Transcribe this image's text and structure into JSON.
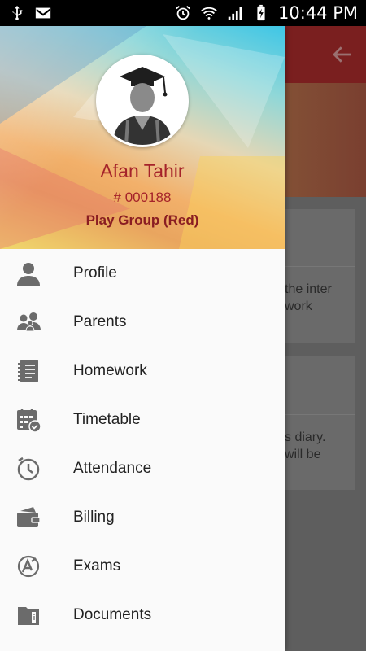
{
  "status_bar": {
    "time": "10:44 PM",
    "icons": [
      "usb-icon",
      "gmail-icon",
      "alarm-icon",
      "wifi-icon",
      "signal-icon",
      "battery-icon"
    ]
  },
  "background": {
    "card1_text": [
      "the inter",
      "work"
    ],
    "card2_text": [
      "s diary.",
      "will be"
    ]
  },
  "drawer": {
    "student": {
      "name": "Afan Tahir",
      "id": "# 000188",
      "class": "Play Group (Red)"
    },
    "menu": [
      {
        "label": "Profile",
        "icon": "person-icon"
      },
      {
        "label": "Parents",
        "icon": "parents-icon"
      },
      {
        "label": "Homework",
        "icon": "notebook-icon"
      },
      {
        "label": "Timetable",
        "icon": "calendar-icon"
      },
      {
        "label": "Attendance",
        "icon": "clock-icon"
      },
      {
        "label": "Billing",
        "icon": "wallet-icon"
      },
      {
        "label": "Exams",
        "icon": "exam-icon"
      },
      {
        "label": "Documents",
        "icon": "documents-icon"
      }
    ]
  },
  "colors": {
    "accent_red": "#a5232a",
    "icon_gray": "#6b6b6b"
  }
}
